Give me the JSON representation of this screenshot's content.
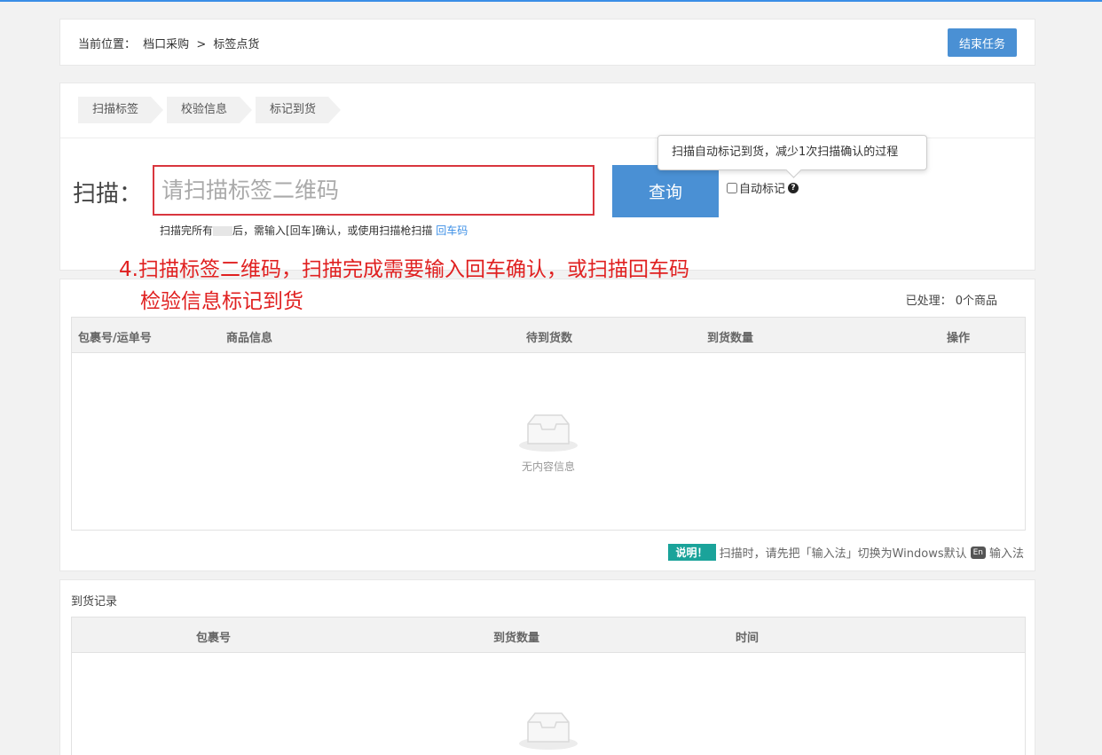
{
  "breadcrumb": {
    "prefix": "当前位置：",
    "item1": "档口采购",
    "sep": ">",
    "item2": "标签点货"
  },
  "header": {
    "end_task_label": "结束任务"
  },
  "steps": [
    "扫描标签",
    "校验信息",
    "标记到货"
  ],
  "scan": {
    "label": "扫描：",
    "placeholder": "请扫描标签二维码",
    "query_label": "查询",
    "auto_mark_label": "自动标记",
    "tooltip": "扫描自动标记到货，减少1次扫描确认的过程",
    "hint_before": "扫描完所有",
    "hint_after": "后，需输入[回车]确认，或使用扫描枪扫描",
    "hint_link": "回车码"
  },
  "annotation": {
    "line1": "4.扫描标签二维码，扫描完成需要输入回车确认，或扫描回车码",
    "line2": "检验信息标记到货"
  },
  "goods": {
    "processed_label": "已处理：",
    "processed_value": "0个商品",
    "columns": [
      "包裹号/运单号",
      "商品信息",
      "待到货数",
      "到货数量",
      "操作"
    ],
    "empty_text": "无内容信息",
    "note_badge": "说明！",
    "note_text1": "扫描时，请先把「输入法」切换为Windows默认",
    "note_en": "En",
    "note_text2": "输入法"
  },
  "records": {
    "title": "到货记录",
    "columns": [
      "包裹号",
      "到货数量",
      "时间"
    ]
  },
  "colors": {
    "primary": "#4a90d4",
    "danger": "#d9363e",
    "annotation": "#e02020",
    "teal": "#1aa39a"
  }
}
